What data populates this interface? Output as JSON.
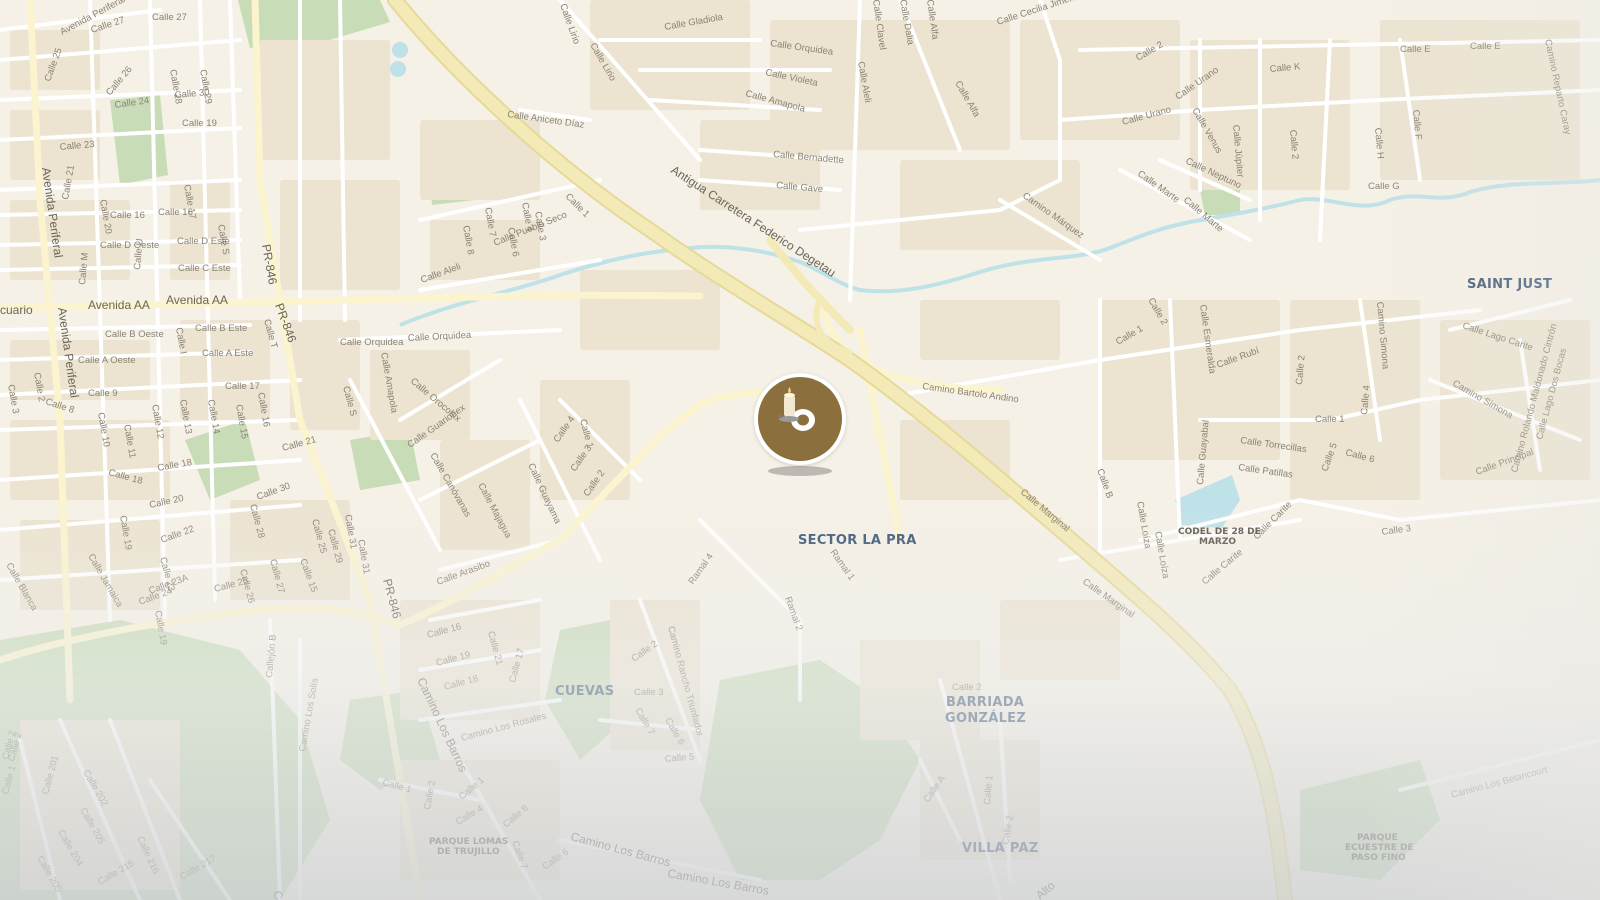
{
  "map": {
    "colors": {
      "land": "#f6f1e6",
      "block": "#ece4d1",
      "road_minor": "#ffffff",
      "road_major": "#f3eab8",
      "road_major_edge": "#e6d998",
      "park": "#c9dcb8",
      "water": "#bfe1e8",
      "marker": "#8b6f3c",
      "area_text": "#3e5877"
    },
    "marker": {
      "icon": "candle-icon",
      "label": ""
    },
    "areas": [
      {
        "id": "sector-la-pra",
        "text": "SECTOR LA PRA"
      },
      {
        "id": "cuevas",
        "text": "CUEVAS"
      },
      {
        "id": "barriada-gonzalez-1",
        "text": "BARRIADA"
      },
      {
        "id": "barriada-gonzalez-2",
        "text": "GONZÁLEZ"
      },
      {
        "id": "villa-paz",
        "text": "VILLA PAZ"
      },
      {
        "id": "saint-just",
        "text": "SAINT JUST"
      }
    ],
    "pois": [
      {
        "id": "codel-1",
        "text": "CODEL DE 28 DE"
      },
      {
        "id": "codel-2",
        "text": "MARZO"
      },
      {
        "id": "parque-lomas-1",
        "text": "PARQUE LOMAS"
      },
      {
        "id": "parque-lomas-2",
        "text": "DE TRUJILLO"
      },
      {
        "id": "parque-ecuestre-1",
        "text": "PARQUE"
      },
      {
        "id": "parque-ecuestre-2",
        "text": "ECUESTRE DE"
      },
      {
        "id": "parque-ecuestre-3",
        "text": "PASO FINO"
      }
    ],
    "streets": [
      "Avenida Periferal",
      "Calle 27",
      "Calle 27",
      "Calle 25",
      "Calle 26",
      "Calle 28",
      "Calle 29",
      "Calle 24",
      "Calle 30",
      "Calle 19",
      "Calle 23",
      "Calle 21",
      "Calle 20",
      "Calle 17",
      "Calle 16",
      "Calle 16",
      "Calle S",
      "Calle D Oeste",
      "Calle D Este",
      "Calle M",
      "Calle U",
      "Calle C Este",
      "cuario",
      "Avenida AA",
      "Avenida AA",
      "PR-846",
      "PR-846",
      "PR-846",
      "Avenida Periferal",
      "Avenida Periferal",
      "Calle B Oeste",
      "Calle B Este",
      "Calle I",
      "Calle T",
      "Calle A Oeste",
      "Calle A Este",
      "Calle 3",
      "Calle 2",
      "Calle 8",
      "Calle 9",
      "Calle 17",
      "Calle 10",
      "Calle 11",
      "Calle 12",
      "Calle 13",
      "Calle 14",
      "Calle 15",
      "Calle 16",
      "Calle 18",
      "Calle 18",
      "Calle 21",
      "Calle 20",
      "Calle 22",
      "Calle 19",
      "Calle 30",
      "Calle 28",
      "Calle 25",
      "Calle 29",
      "Calle 31",
      "Calle 31",
      "Calle Jamaica",
      "Calle Blanca",
      "Calle 23",
      "Calle 23A",
      "Calle 24",
      "Calle 25",
      "Calle 26",
      "Calle 27",
      "Calle 15",
      "Calle 19",
      "Calle Lirio",
      "Calle Lirio",
      "Calle Gladiola",
      "Calle Orquidea",
      "Calle Violeta",
      "Calle Amapola",
      "Calle Aniceto Díaz",
      "Calle Bernadette",
      "Calle Gave",
      "Calle Aleli",
      "Antigua Carretera Federico Degetau",
      "Calle 1",
      "Calle 7",
      "Calle 4",
      "Calle 3",
      "Calle 8",
      "Calle 6",
      "Calle Pueblo Seco",
      "Calle Aleli",
      "Calle Orquidea",
      "Calle Orquidea",
      "Calle Amapola",
      "Calle S",
      "Calle Orocobix",
      "Calle Guarionex",
      "Calle Canóvanas",
      "Calle Majagua",
      "Calle Guayama",
      "Calle Arasibo",
      "Calle 4",
      "Calle 3",
      "Calle 1",
      "Calle 2",
      "Ramal 4",
      "Ramal 1",
      "Ramal 2",
      "Calle Dalia",
      "Calle Clavel",
      "Calle Alfa",
      "Calle Alfa",
      "Calle Cecilia Jiménez",
      "Calle 2",
      "Calle Urano",
      "Calle Urano",
      "Calle Venus",
      "Calle Júpiter",
      "Calle Neptuno",
      "Calle Marte",
      "Calle Marte",
      "Camino Márquez",
      "Calle E",
      "Calle E",
      "Calle K",
      "Calle 2",
      "Calle H",
      "Calle F",
      "Calle G",
      "Camino Reparto Caray",
      "Camino Bartolo Andino",
      "Calle 2",
      "Calle 1",
      "Calle Esmeralda",
      "Calle Rubí",
      "Camino Simona",
      "Calle 2",
      "Calle 4",
      "Calle 1",
      "Calle Torrecillas",
      "Calle Patillas",
      "Calle 5",
      "Calle 6",
      "Calle Guayabal",
      "Calle Loíza",
      "Calle Loíza",
      "Calle B",
      "Calle Carite",
      "Calle Carite",
      "Calle 3",
      "Calle Principal",
      "Calle Lago Carite",
      "Camino Simona",
      "Camino Rolando Maldonado Cintrón",
      "Calle Lago Dos Bocas",
      "Calle Marginal",
      "Calle Marginal",
      "Calle 16",
      "Calle 19",
      "Calle 18",
      "Calle 21",
      "Calle 17",
      "Calle 2",
      "Calle 3",
      "Calle 7",
      "Calle 6",
      "Calle 5",
      "Camino Rancho Triunfador",
      "Camino Los Rosales",
      "Camino Los Barros",
      "Camino Los Barros",
      "Camino Los Barros",
      "Camino Los Solís",
      "Callejón B",
      "Calle 1",
      "Calle 1",
      "Calle 4",
      "Calle 2",
      "Calle 8",
      "Calle 6",
      "Calle 7",
      "Calle 2",
      "Calle 201",
      "Calle 202",
      "Calle 205",
      "Calle 204",
      "Calle 215",
      "Calle 216",
      "Calle 217",
      "Calle 205",
      "Calle 2",
      "Calle 1",
      "Calle A",
      "Calle 1",
      "Calle 2",
      "Calle 2",
      "Camino Los Betancourt",
      "Alto",
      "Car"
    ]
  }
}
